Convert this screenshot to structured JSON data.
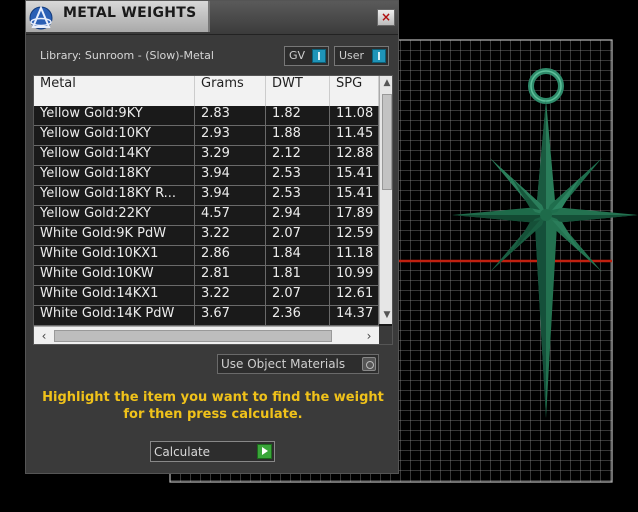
{
  "window": {
    "title": "METAL WEIGHTS",
    "close_label": "×"
  },
  "library_label": "Library: Sunroom - (Slow)-Metal",
  "toggles": {
    "gv": "GV",
    "user": "User"
  },
  "table": {
    "columns": [
      "Metal",
      "Grams",
      "DWT",
      "SPG"
    ],
    "rows": [
      [
        "Yellow Gold:9KY",
        "2.83",
        "1.82",
        "11.08"
      ],
      [
        "Yellow Gold:10KY",
        "2.93",
        "1.88",
        "11.45"
      ],
      [
        "Yellow Gold:14KY",
        "3.29",
        "2.12",
        "12.88"
      ],
      [
        "Yellow Gold:18KY",
        "3.94",
        "2.53",
        "15.41"
      ],
      [
        "Yellow Gold:18KY R...",
        "3.94",
        "2.53",
        "15.41"
      ],
      [
        "Yellow Gold:22KY",
        "4.57",
        "2.94",
        "17.89"
      ],
      [
        "White Gold:9K PdW",
        "3.22",
        "2.07",
        "12.59"
      ],
      [
        "White Gold:10KX1",
        "2.86",
        "1.84",
        "11.18"
      ],
      [
        "White Gold:10KW",
        "2.81",
        "1.81",
        "10.99"
      ],
      [
        "White Gold:14KX1",
        "3.22",
        "2.07",
        "12.61"
      ],
      [
        "White Gold:14K PdW",
        "3.67",
        "2.36",
        "14.37"
      ]
    ]
  },
  "use_object_materials_label": "Use Object Materials",
  "instructions": "Highlight the item you want to find the weight for then press calculate.",
  "calculate_label": "Calculate",
  "colors": {
    "instruction_text": "#f0c21a",
    "model": "#1e6b4a",
    "axis_line": "#c0200f",
    "grid": "#9a9a9a",
    "toggle_on": "#1f94b8"
  },
  "icons": [
    "app-logo-icon",
    "close-icon",
    "scroll-up-icon",
    "scroll-down-icon",
    "scroll-left-icon",
    "scroll-right-icon",
    "toggle-knob-icon",
    "play-icon"
  ]
}
